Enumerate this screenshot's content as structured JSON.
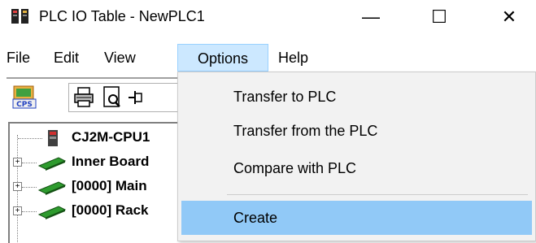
{
  "window": {
    "title": "PLC IO Table - NewPLC1",
    "minimize_symbol": "—",
    "maximize_symbol": "☐",
    "close_symbol": "✕"
  },
  "menubar": {
    "items": [
      {
        "label": "File"
      },
      {
        "label": "Edit"
      },
      {
        "label": "View"
      },
      {
        "label": "Options"
      },
      {
        "label": "Help"
      }
    ]
  },
  "options_menu": {
    "items": [
      {
        "label": "Transfer to PLC"
      },
      {
        "label": "Transfer from the PLC"
      },
      {
        "label": "Compare with PLC"
      },
      {
        "label": "Create"
      }
    ]
  },
  "toolbar": {
    "cps_icon_text": "CPS"
  },
  "tree": {
    "items": [
      {
        "label": "CJ2M-CPU1"
      },
      {
        "label": "Inner Board"
      },
      {
        "label": "[0000] Main"
      },
      {
        "label": "[0000] Rack"
      }
    ]
  },
  "colors": {
    "menu_highlight": "#cce8ff",
    "menu_highlight_border": "#99d1ff",
    "dropdown_bg": "#f2f2f2",
    "dropdown_hover": "#91c9f7",
    "board_green": "#2e9b2e"
  }
}
